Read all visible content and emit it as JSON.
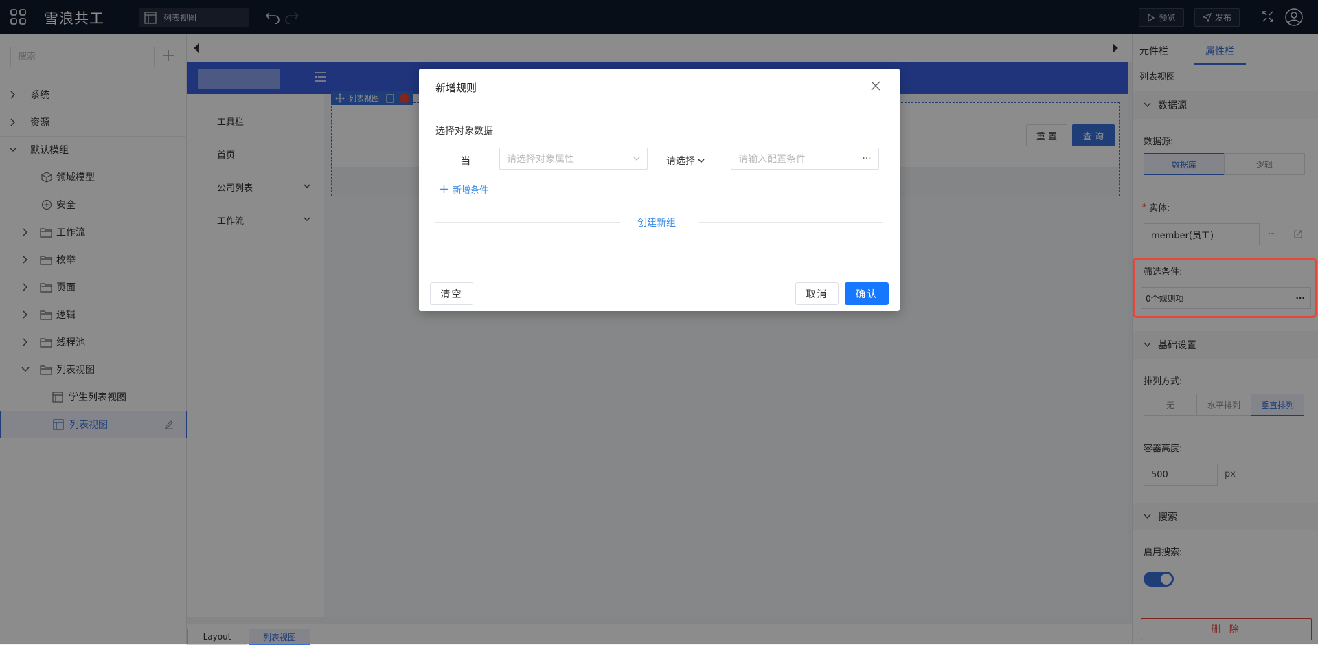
{
  "app": {
    "brand": "雪浪共工",
    "page_tab": "列表视图"
  },
  "toolbar": {
    "preview": "预览",
    "publish": "发布"
  },
  "left": {
    "search_placeholder": "搜索",
    "tree": [
      {
        "label": "系统"
      },
      {
        "label": "资源"
      },
      {
        "label": "默认模组"
      },
      {
        "label": "领域模型"
      },
      {
        "label": "安全"
      },
      {
        "label": "工作流"
      },
      {
        "label": "枚举"
      },
      {
        "label": "页面"
      },
      {
        "label": "逻辑"
      },
      {
        "label": "线程池"
      },
      {
        "label": "列表视图"
      },
      {
        "label": "学生列表视图"
      },
      {
        "label": "列表视图"
      }
    ]
  },
  "canvas": {
    "nav": [
      "工具栏",
      "首页",
      "公司列表",
      "工作流"
    ],
    "selected_tag": "列表视图",
    "reset": "重 置",
    "query": "查 询",
    "breadcrumb": [
      "Layout",
      "列表视图"
    ]
  },
  "right": {
    "tabs": [
      "元件栏",
      "属性栏"
    ],
    "component_name": "列表视图",
    "datasource_section": "数据源",
    "datasource_label": "数据源:",
    "datasource_options": [
      "数据库",
      "逻辑"
    ],
    "entity_label": "实体:",
    "entity_required": "*",
    "entity_value": "member(员工)",
    "filter_label": "筛选条件:",
    "filter_value": "0个规则项",
    "basic_section": "基础设置",
    "sort_label": "排列方式:",
    "sort_options": [
      "无",
      "水平排列",
      "垂直排列"
    ],
    "height_label": "容器高度:",
    "height_value": "500",
    "height_unit": "px",
    "search_section": "搜索",
    "enable_search_label": "启用搜索:",
    "enable_search": true,
    "delete": "删 除"
  },
  "modal": {
    "title": "新增规则",
    "select_object_label": "选择对象数据",
    "when": "当",
    "attr_placeholder": "请选择对象属性",
    "operator": "请选择",
    "condition_placeholder": "请输入配置条件",
    "more": "···",
    "add_condition": "新增条件",
    "create_group": "创建新组",
    "clear": "清空",
    "cancel": "取消",
    "confirm": "确认"
  },
  "colors": {
    "accent": "#3a6fd8",
    "primary": "#1677ff",
    "highlight": "#e8453c",
    "topbar": "#101a2d"
  }
}
